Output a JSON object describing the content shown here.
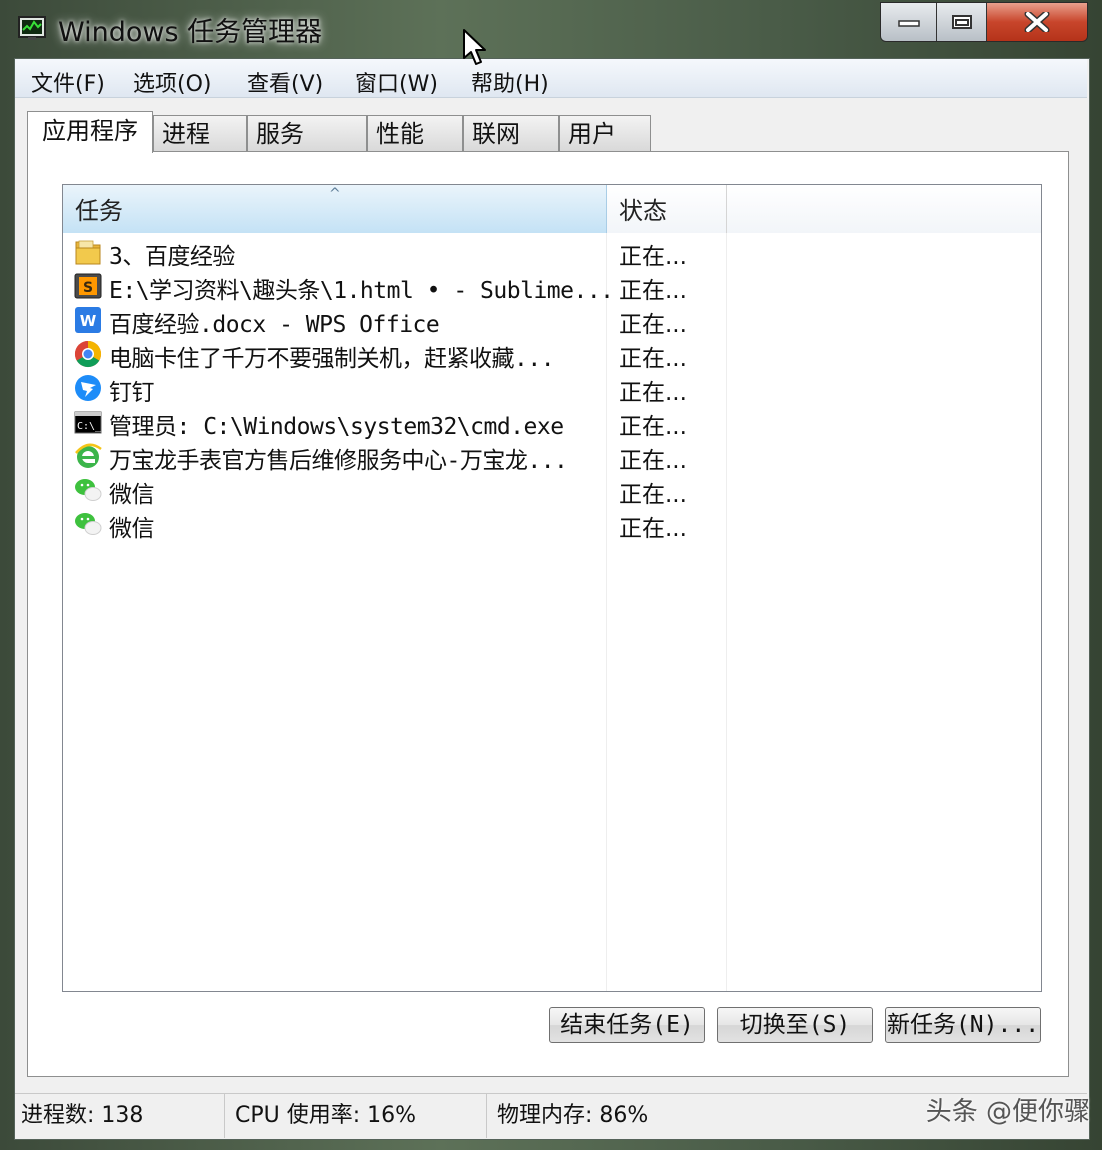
{
  "window": {
    "title": "Windows 任务管理器",
    "controls": {
      "minimize": "minimize",
      "maximize": "maximize",
      "close": "close"
    }
  },
  "menu": [
    {
      "label": "文件(F)"
    },
    {
      "label": "选项(O)"
    },
    {
      "label": "查看(V)"
    },
    {
      "label": "窗口(W)"
    },
    {
      "label": "帮助(H)"
    }
  ],
  "tabs": [
    {
      "label": "应用程序",
      "active": true
    },
    {
      "label": "进程"
    },
    {
      "label": "服务"
    },
    {
      "label": "性能"
    },
    {
      "label": "联网"
    },
    {
      "label": "用户"
    }
  ],
  "list": {
    "columns": [
      "任务",
      "状态"
    ],
    "sorted_column": "任务",
    "rows": [
      {
        "icon": "folder-icon",
        "name": "3、百度经验",
        "status": "正在..."
      },
      {
        "icon": "sublime-text-icon",
        "name": "E:\\学习资料\\趣头条\\1.html • - Sublime...",
        "status": "正在..."
      },
      {
        "icon": "wps-writer-icon",
        "name": "百度经验.docx - WPS Office",
        "status": "正在..."
      },
      {
        "icon": "chrome-icon",
        "name": "电脑卡住了千万不要强制关机，赶紧收藏...",
        "status": "正在..."
      },
      {
        "icon": "dingtalk-icon",
        "name": "钉钉",
        "status": "正在..."
      },
      {
        "icon": "cmd-icon",
        "name": "管理员: C:\\Windows\\system32\\cmd.exe",
        "status": "正在..."
      },
      {
        "icon": "ie-browser-icon",
        "name": "万宝龙手表官方售后维修服务中心-万宝龙...",
        "status": "正在..."
      },
      {
        "icon": "wechat-icon",
        "name": "微信",
        "status": "正在..."
      },
      {
        "icon": "wechat-icon",
        "name": "微信",
        "status": "正在..."
      }
    ]
  },
  "buttons": {
    "end_task": "结束任务(E)",
    "switch_to": "切换至(S)",
    "new_task": "新任务(N)..."
  },
  "status_bar": {
    "processes": "进程数: 138",
    "cpu": "CPU 使用率: 16%",
    "memory": "物理内存: 86%"
  },
  "watermark": "头条 @便你骤"
}
